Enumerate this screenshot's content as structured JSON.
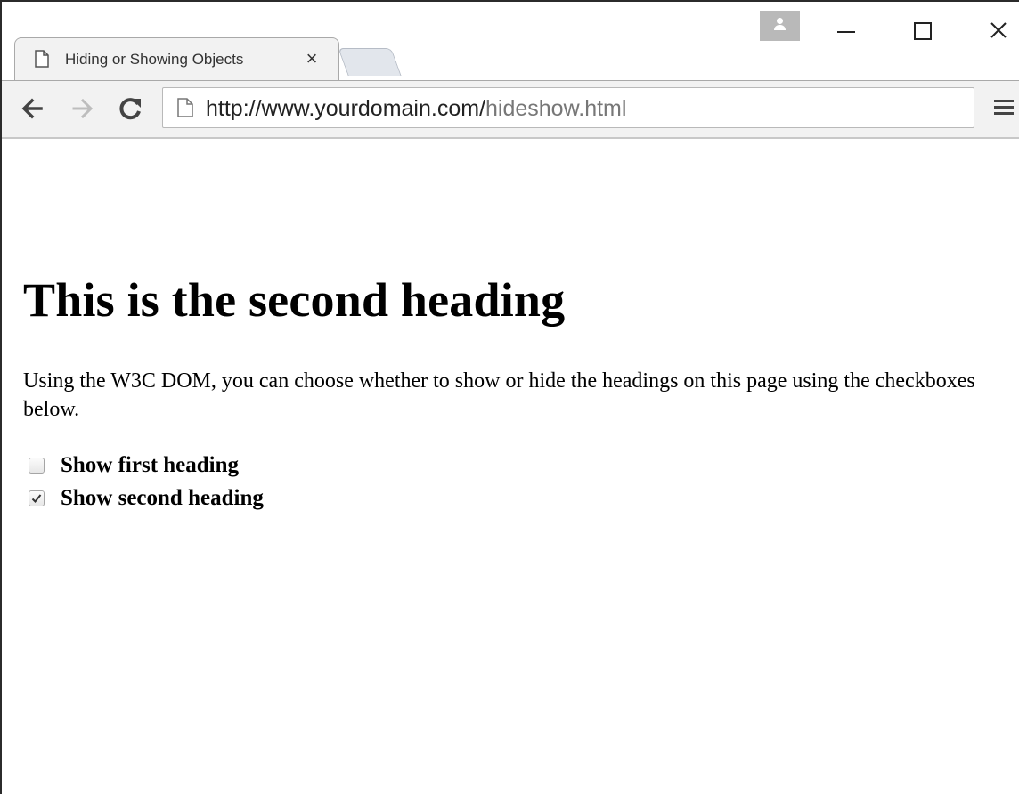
{
  "browser": {
    "tab_title": "Hiding or Showing Objects",
    "url_domain": "http://www.yourdomain.com/",
    "url_path": "hideshow.html"
  },
  "page": {
    "heading": "This is the second heading",
    "intro": "Using the W3C DOM, you can choose whether to show or hide the headings on this page using the checkboxes below.",
    "checkboxes": [
      {
        "label": "Show first heading",
        "checked": false
      },
      {
        "label": "Show second heading",
        "checked": true
      }
    ]
  }
}
